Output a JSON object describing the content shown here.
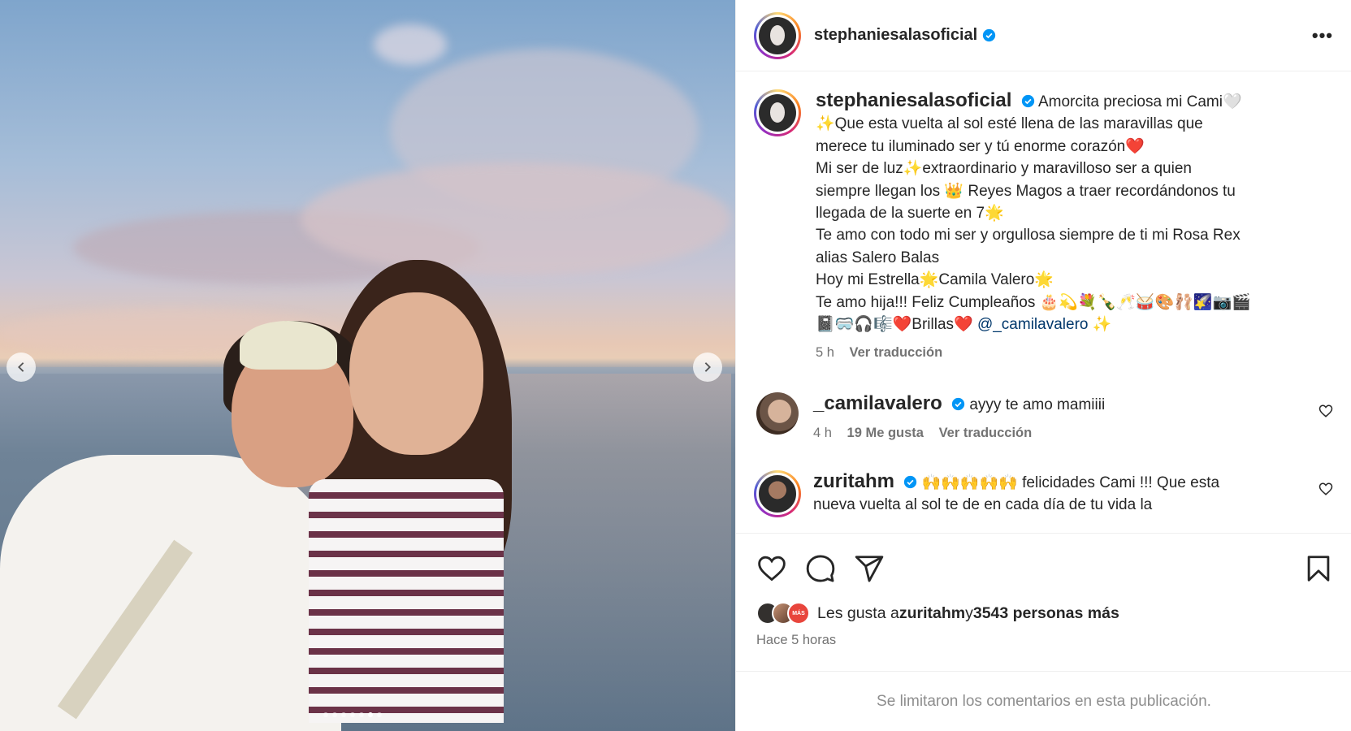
{
  "post": {
    "username": "stephaniesalasoficial",
    "more_label": "•••"
  },
  "carousel": {
    "slide_count": 7,
    "active_index": 5
  },
  "caption": {
    "username": "stephaniesalasoficial",
    "lines": [
      "Amorcita preciosa mi Cami🤍",
      "✨Que esta vuelta al sol esté llena de las maravillas que",
      "merece tu iluminado ser y tú enorme corazón❤️",
      "Mi ser de luz✨extraordinario y maravilloso ser a quien",
      "siempre llegan los 👑 Reyes Magos a traer recordándonos tu",
      "llegada de la suerte en 7🌟",
      "Te amo con todo mi ser y orgullosa siempre de ti mi Rosa Rex",
      "alias Salero Balas",
      "Hoy mi Estrella🌟Camila Valero🌟",
      "Te amo hija!!! Feliz Cumpleaños 🎂💫💐🍾🥂🥁🎨🩰🌠📷🎬",
      "📓🥽🎧🎼❤️Brillas❤️ "
    ],
    "mention": "@_camilavalero",
    "trailing": " ✨",
    "time": "5 h",
    "translate": "Ver traducción"
  },
  "comments": [
    {
      "username": "_camilavalero",
      "text": "ayyy te amo mamiiii",
      "time": "4 h",
      "likes": "19 Me gusta",
      "translate": "Ver traducción"
    },
    {
      "username": "zuritahm",
      "text": "🙌🙌🙌🙌🙌 felicidades Cami !!! Que esta",
      "text2": "nueva vuelta al sol te de en cada día de tu vida la"
    }
  ],
  "likes": {
    "prefix": "Les gusta a ",
    "user": "zuritahm",
    "middle": " y ",
    "count_text": "3543 personas más",
    "mini_badge": "MÁS"
  },
  "time_ago": "Hace 5 horas",
  "footer": "Se limitaron los comentarios en esta publicación."
}
